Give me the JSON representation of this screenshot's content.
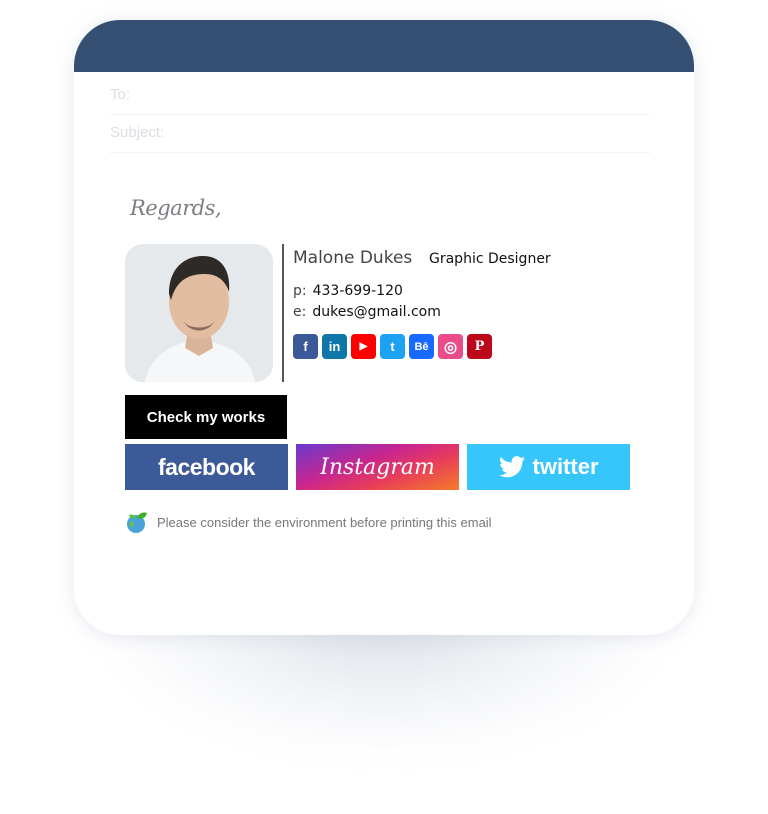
{
  "email": {
    "to_label": "To:",
    "subject_label": "Subject:"
  },
  "signature": {
    "closing": "Regards,",
    "name": "Malone Dukes",
    "title": "Graphic Designer",
    "phone_label": "p:",
    "phone": "433-699-120",
    "email_label": "e:",
    "email": "dukes@gmail.com",
    "socials": [
      {
        "name": "facebook",
        "glyph": "f",
        "color": "#3b5998"
      },
      {
        "name": "linkedin",
        "glyph": "in",
        "color": "#0e76a8"
      },
      {
        "name": "youtube",
        "glyph": "▶",
        "color": "#ff0000"
      },
      {
        "name": "twitter",
        "glyph": "t",
        "color": "#1da1f2"
      },
      {
        "name": "behance",
        "glyph": "Bē",
        "color": "#1769ff"
      },
      {
        "name": "dribbble",
        "glyph": "◎",
        "color": "#ea4c89"
      },
      {
        "name": "pinterest",
        "glyph": "P",
        "color": "#bd081c"
      }
    ],
    "cta_label": "Check my works",
    "banners": {
      "facebook": "facebook",
      "instagram": "Instagram",
      "twitter": "twitter"
    },
    "eco_note": "Please consider the environment before printing this email"
  },
  "colors": {
    "header": "#344f72"
  }
}
